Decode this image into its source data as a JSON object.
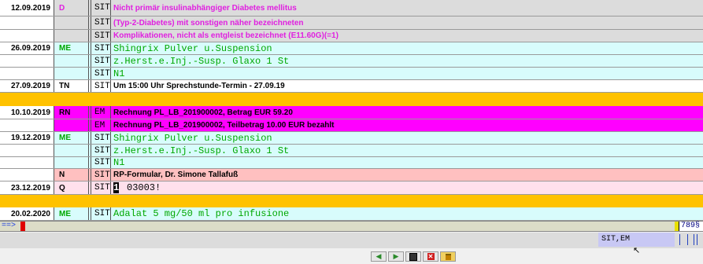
{
  "colors": {
    "gray_row": "#dcdcdc",
    "cyan_row": "#d8fcfc",
    "white_row": "#ffffff",
    "magenta_row": "#ff00ff",
    "pink_row": "#ffc0c0",
    "lightpink_row": "#ffe0ec",
    "separator": "#ffc200",
    "magenta_text": "#e020e0",
    "green_text": "#00a800"
  },
  "rows": [
    {
      "date": "12.09.2019",
      "type": "D",
      "code": "SIT",
      "text": "Nicht primär insulinabhängiger Diabetes mellitus"
    },
    {
      "date": "",
      "type": "",
      "code": "SIT",
      "text": "(Typ-2-Diabetes) mit sonstigen näher bezeichneten"
    },
    {
      "date": "",
      "type": "",
      "code": "SIT",
      "text": "Komplikationen, nicht als entgleist bezeichnet (E11.60G)(=1)"
    },
    {
      "date": "26.09.2019",
      "type": "ME",
      "code": "SIT",
      "text": "Shingrix Pulver u.Suspension"
    },
    {
      "date": "",
      "type": "",
      "code": "SIT",
      "text": "z.Herst.e.Inj.-Susp. Glaxo 1 St"
    },
    {
      "date": "",
      "type": "",
      "code": "SIT",
      "text": "N1"
    },
    {
      "date": "27.09.2019",
      "type": "TN",
      "code": "SIT",
      "text": "Um 15:00 Uhr Sprechstunde-Termin - 27.09.19"
    },
    {
      "date": "10.10.2019",
      "type": "RN",
      "code": "EM",
      "text": "Rechnung PL_LB_201900002, Betrag EUR 59.20"
    },
    {
      "date": "",
      "type": "",
      "code": "EM",
      "text": "Rechnung PL_LB_201900002, Teilbetrag 10.00 EUR bezahlt"
    },
    {
      "date": "19.12.2019",
      "type": "ME",
      "code": "SIT",
      "text": "Shingrix Pulver u.Suspension"
    },
    {
      "date": "",
      "type": "",
      "code": "SIT",
      "text": "z.Herst.e.Inj.-Susp. Glaxo 1 St"
    },
    {
      "date": "",
      "type": "",
      "code": "SIT",
      "text": "N1"
    },
    {
      "date": "",
      "type": "N",
      "code": "SIT",
      "text": "RP-Formular, Dr. Simone Tallafuß"
    },
    {
      "date": "23.12.2019",
      "type": "Q",
      "code": "SIT",
      "cursor": "1",
      "text": "03003!"
    },
    {
      "date": "20.02.2020",
      "type": "ME",
      "code": "SIT",
      "text": "Adalat 5 mg/50 ml pro infusione"
    }
  ],
  "commandline": {
    "prompt": "==>",
    "counter": "789§"
  },
  "status": {
    "text": "SIT,EM"
  },
  "toolbar": {
    "buttons": [
      {
        "icon": "back-arrow-icon"
      },
      {
        "icon": "forward-arrow-icon"
      },
      {
        "icon": "save-disk-icon"
      },
      {
        "icon": "close-x-icon"
      },
      {
        "icon": "lock-icon"
      }
    ]
  }
}
